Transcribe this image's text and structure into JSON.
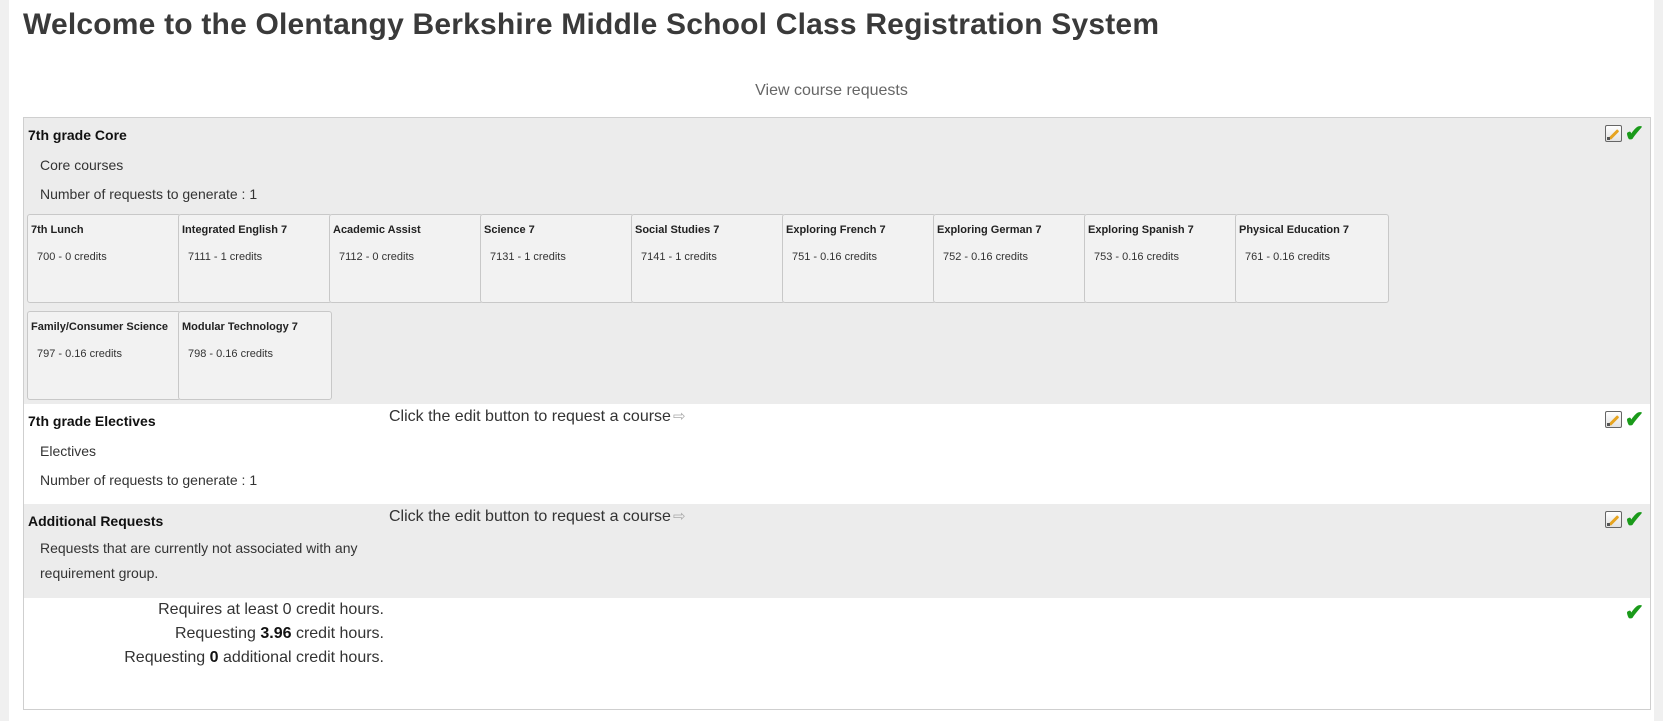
{
  "page_title": "Welcome to the Olentangy Berkshire Middle School Class Registration System",
  "view_requests_label": "View course requests",
  "groups": [
    {
      "title": "7th grade Core",
      "description": "Core courses",
      "count_text": "Number of requests to generate : 1",
      "courses": [
        {
          "name": "7th Lunch",
          "meta": "700 - 0 credits"
        },
        {
          "name": "Integrated English 7",
          "meta": "7111 - 1 credits"
        },
        {
          "name": "Academic Assist",
          "meta": "7112 - 0 credits"
        },
        {
          "name": "Science 7",
          "meta": "7131 - 1 credits"
        },
        {
          "name": "Social Studies 7",
          "meta": "7141 - 1 credits"
        },
        {
          "name": "Exploring French 7",
          "meta": "751 - 0.16 credits"
        },
        {
          "name": "Exploring German 7",
          "meta": "752 - 0.16 credits"
        },
        {
          "name": "Exploring Spanish 7",
          "meta": "753 - 0.16 credits"
        },
        {
          "name": "Physical Education 7",
          "meta": "761 - 0.16 credits"
        },
        {
          "name": "Family/Consumer Science",
          "meta": "797 - 0.16 credits"
        },
        {
          "name": "Modular Technology 7",
          "meta": "798 - 0.16 credits"
        }
      ]
    },
    {
      "title": "7th grade Electives",
      "description": "Electives",
      "count_text": "Number of requests to generate : 1",
      "hint": "Click the edit button to request a course"
    },
    {
      "title": "Additional Requests",
      "description_line1": "Requests that are currently not associated with any",
      "description_line2": "requirement group.",
      "hint": "Click the edit button to request a course"
    }
  ],
  "summary": {
    "requires_text": "Requires at least 0 credit hours.",
    "requesting_prefix": "Requesting",
    "requesting_value": "3.96",
    "requesting_suffix": "credit hours.",
    "additional_prefix": "Requesting",
    "additional_value": "0",
    "additional_suffix": "additional credit hours."
  },
  "icons": {
    "check": "✔",
    "arrow": "⇨"
  },
  "colors": {
    "group_bg": "#ececec",
    "check": "#1a9a1a",
    "card_bg": "#f2f2f2"
  }
}
